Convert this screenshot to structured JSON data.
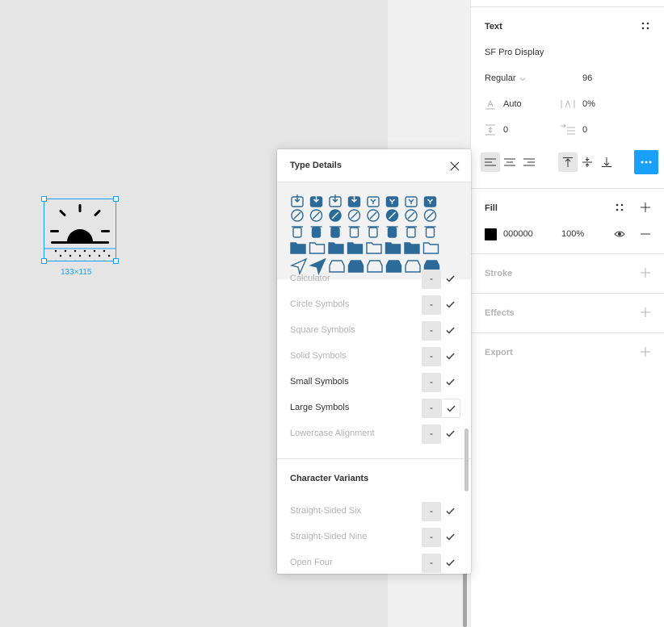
{
  "canvas": {
    "selection_dimensions": "133×115"
  },
  "panel": {
    "text_section": {
      "title": "Text",
      "font_family": "SF Pro Display",
      "font_weight": "Regular",
      "font_size": "96",
      "line_height": "Auto",
      "letter_spacing": "0%",
      "paragraph_spacing": "0",
      "paragraph_indent": "0"
    },
    "fill_section": {
      "title": "Fill",
      "hex": "000000",
      "opacity": "100%",
      "swatch_color": "#000000"
    },
    "stroke_title": "Stroke",
    "effects_title": "Effects",
    "export_title": "Export",
    "accent_color": "#18a0fb"
  },
  "type_details": {
    "title": "Type Details",
    "features": [
      {
        "label": "Calculator",
        "enabled": false
      },
      {
        "label": "Circle Symbols",
        "enabled": false
      },
      {
        "label": "Square Symbols",
        "enabled": false
      },
      {
        "label": "Solid Symbols",
        "enabled": false
      },
      {
        "label": "Small Symbols",
        "enabled": true
      },
      {
        "label": "Large Symbols",
        "enabled": true
      },
      {
        "label": "Lowercase Alignment",
        "enabled": false
      }
    ],
    "character_variants_title": "Character Variants",
    "variants": [
      {
        "label": "Straight-Sided Six",
        "enabled": false
      },
      {
        "label": "Straight-Sided Nine",
        "enabled": false
      },
      {
        "label": "Open Four",
        "enabled": false
      },
      {
        "label": "",
        "enabled": false
      }
    ],
    "dash_label": "-"
  }
}
